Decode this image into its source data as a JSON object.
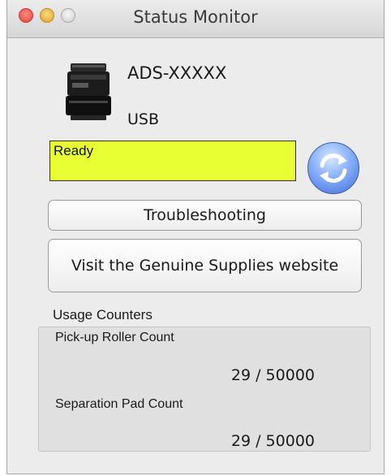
{
  "window": {
    "title": "Status Monitor"
  },
  "device": {
    "icon": "scanner-icon",
    "model": "ADS-XXXXX",
    "interface": "USB"
  },
  "status": {
    "text": "Ready",
    "color": "#e8ff33"
  },
  "buttons": {
    "refresh_icon": "refresh-icon",
    "troubleshooting": "Troubleshooting",
    "supplies": "Visit the Genuine Supplies website"
  },
  "usage": {
    "heading": "Usage Counters",
    "counters": [
      {
        "label": "Pick-up Roller Count",
        "value": "29 / 50000"
      },
      {
        "label": "Separation Pad Count",
        "value": "29 / 50000"
      }
    ]
  }
}
